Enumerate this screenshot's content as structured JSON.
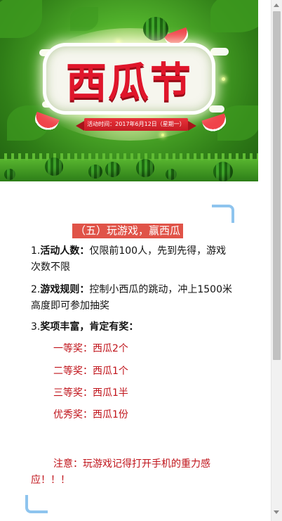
{
  "banner": {
    "title": "西瓜节",
    "date_ribbon": "活动时间：2017年6月12日（星期一）"
  },
  "section": {
    "title": "（五）玩游戏，赢西瓜"
  },
  "items": [
    {
      "prefix": "1.",
      "label": "活动人数：",
      "text": "仅限前100人，先到先得，游戏次数不限"
    },
    {
      "prefix": "2.",
      "label": "游戏规则：",
      "text": "控制小西瓜的跳动，冲上1500米高度即可参加抽奖"
    },
    {
      "prefix": "3.",
      "label": "奖项丰富，肯定有奖：",
      "text": ""
    }
  ],
  "prizes": [
    "一等奖：西瓜2个",
    "二等奖：西瓜1个",
    "三等奖：西瓜1半",
    "优秀奖：西瓜1份"
  ],
  "note": "注意：玩游戏记得打开手机的重力感应！！！",
  "colors": {
    "accent_red": "#e05348",
    "prize_red": "#c0141b",
    "corner_blue": "#8ec4ee"
  }
}
